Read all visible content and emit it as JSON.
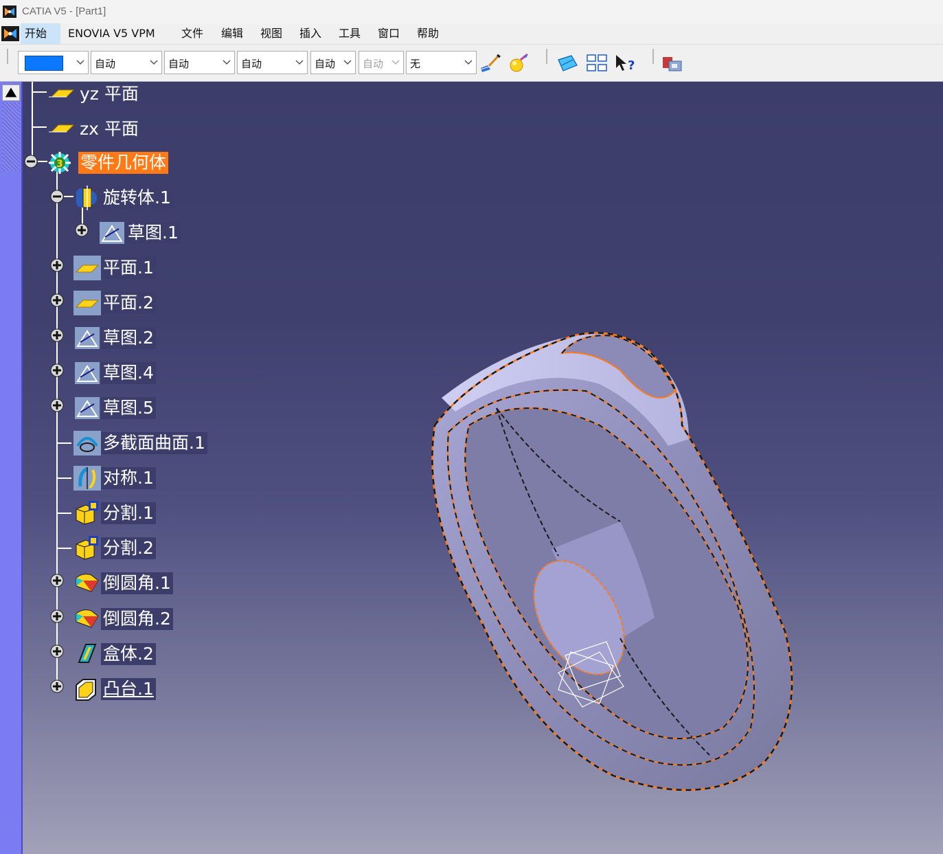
{
  "window": {
    "title": "CATIA V5 - [Part1]"
  },
  "menu": {
    "items": [
      "开始",
      "ENOVIA V5 VPM",
      "文件",
      "编辑",
      "视图",
      "插入",
      "工具",
      "窗口",
      "帮助"
    ]
  },
  "toolbar": {
    "color_combo": {
      "color": "#0a78ff"
    },
    "combos": [
      "自动",
      "自动",
      "自动",
      "自动",
      "自动",
      "无"
    ],
    "icons": [
      "painter-brush-icon",
      "graphic-properties-icon",
      "sketch-plane-icon",
      "catalog-icon",
      "whats-this-icon",
      "multi-body-icon"
    ]
  },
  "tree": {
    "nodes": [
      {
        "label": "yz 平面",
        "icon": "plane-icon",
        "expander": "none"
      },
      {
        "label": "zx 平面",
        "icon": "plane-icon",
        "expander": "none"
      },
      {
        "label": "零件几何体",
        "icon": "part-body-icon",
        "expander": "minus",
        "selected": true
      },
      {
        "label": "旋转体.1",
        "icon": "shaft-icon",
        "expander": "minus"
      },
      {
        "label": "草图.1",
        "icon": "sketch-icon",
        "expander": "plus"
      },
      {
        "label": "平面.1",
        "icon": "plane-icon",
        "expander": "plus"
      },
      {
        "label": "平面.2",
        "icon": "plane-icon",
        "expander": "plus"
      },
      {
        "label": "草图.2",
        "icon": "sketch-icon",
        "expander": "plus"
      },
      {
        "label": "草图.4",
        "icon": "sketch-icon",
        "expander": "plus"
      },
      {
        "label": "草图.5",
        "icon": "sketch-icon",
        "expander": "plus"
      },
      {
        "label": "多截面曲面.1",
        "icon": "multi-section-surface-icon",
        "expander": "none"
      },
      {
        "label": "对称.1",
        "icon": "symmetry-icon",
        "expander": "none"
      },
      {
        "label": "分割.1",
        "icon": "split-icon",
        "expander": "none"
      },
      {
        "label": "分割.2",
        "icon": "split-icon",
        "expander": "none"
      },
      {
        "label": "倒圆角.1",
        "icon": "fillet-icon",
        "expander": "plus"
      },
      {
        "label": "倒圆角.2",
        "icon": "fillet-icon",
        "expander": "plus"
      },
      {
        "label": "盒体.2",
        "icon": "shell-icon",
        "expander": "plus"
      },
      {
        "label": "凸台.1",
        "icon": "pad-icon",
        "expander": "plus",
        "current": true
      }
    ]
  },
  "colors": {
    "viewport_top": "#3c3d6b",
    "viewport_bottom": "#a2a1b9",
    "selection": "#ff7a17",
    "edge_highlight": "#ff7a17",
    "part_surface": "#b9b8e6"
  }
}
